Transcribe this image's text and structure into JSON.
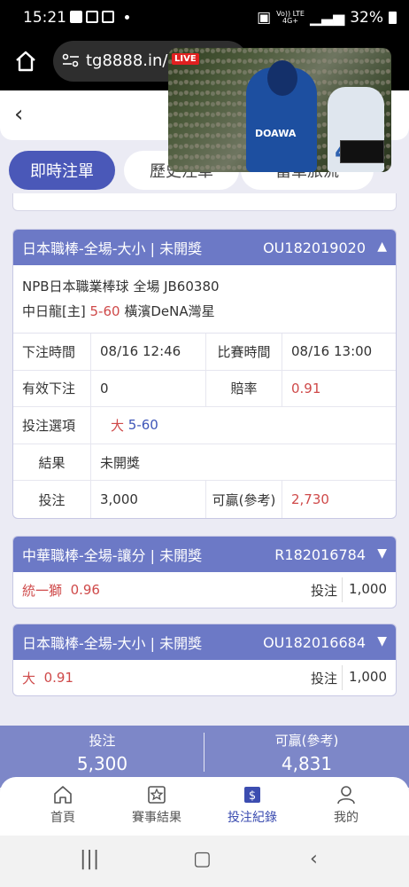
{
  "status_bar": {
    "time": "15:21",
    "network_top": "Vo)) LTE",
    "network_bottom": "4G+",
    "battery": "32%"
  },
  "browser": {
    "url": "tg8888.in/r",
    "live_badge": "LIVE"
  },
  "video": {
    "jersey_text": "DOAWA",
    "catcher_number": "45"
  },
  "tabs": [
    {
      "label": "即時注單"
    },
    {
      "label": "歷史注單"
    },
    {
      "label": "當單旅流"
    }
  ],
  "bets": [
    {
      "title": "日本職棒-全場-大小 | 未開獎",
      "id": "OU182019020",
      "match_line1": "NPB日本職業棒球 全場 JB60380",
      "home": "中日龍[主]",
      "score": "5-60",
      "away": "橫濱DeNA灣星",
      "bet_time_label": "下注時間",
      "bet_time": "08/16 12:46",
      "match_time_label": "比賽時間",
      "match_time": "08/16 13:00",
      "valid_label": "有效下注",
      "valid": "0",
      "odds_label": "賠率",
      "odds": "0.91",
      "option_label": "投注選項",
      "option_pick": "大",
      "option_line": "5-60",
      "result_label": "結果",
      "result": "未開獎",
      "stake_label": "投注",
      "stake": "3,000",
      "win_label": "可贏(參考)",
      "win": "2,730"
    },
    {
      "title": "中華職棒-全場-讓分 | 未開獎",
      "id": "R182016784",
      "pick": "統一獅",
      "odds": "0.96",
      "stake_label": "投注",
      "stake": "1,000"
    },
    {
      "title": "日本職棒-全場-大小 | 未開獎",
      "id": "OU182016684",
      "pick": "大",
      "odds": "0.91",
      "stake_label": "投注",
      "stake": "1,000"
    }
  ],
  "summary": {
    "stake_label": "投注",
    "stake": "5,300",
    "win_label": "可贏(參考)",
    "win": "4,831"
  },
  "nav": [
    {
      "label": "首頁"
    },
    {
      "label": "賽事結果"
    },
    {
      "label": "投注紀錄"
    },
    {
      "label": "我的"
    }
  ],
  "colors": {
    "accent": "#4a58b8",
    "header": "#6c79c6",
    "red": "#cf4a4a",
    "blue": "#3d55b8"
  }
}
